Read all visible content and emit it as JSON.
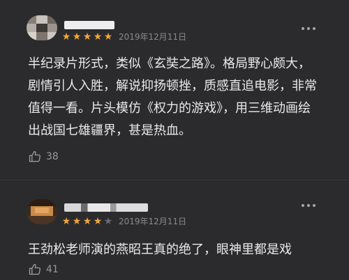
{
  "reviews": [
    {
      "rating": 5,
      "date": "2019年12月11日",
      "content": "半纪录片形式，类似《玄奘之路》。格局野心颇大，剧情引人入胜，解说抑扬顿挫，质感直追电影，非常值得一看。片头模仿《权力的游戏》，用三维动画绘出战国七雄疆界，甚是热血。",
      "likes": "38"
    },
    {
      "rating": 4,
      "date": "2019年12月11日",
      "content": "王劲松老师演的燕昭王真的绝了，眼神里都是戏",
      "likes": "41"
    }
  ],
  "icons": {
    "star": "star-icon",
    "more": "more-dots-icon",
    "like": "thumbs-up-icon"
  },
  "colors": {
    "background": "#2b2b2d",
    "star_on": "#f2a73b",
    "star_off": "#6c6c6e",
    "text": "#eaeaea",
    "meta": "#8b8b8d"
  }
}
